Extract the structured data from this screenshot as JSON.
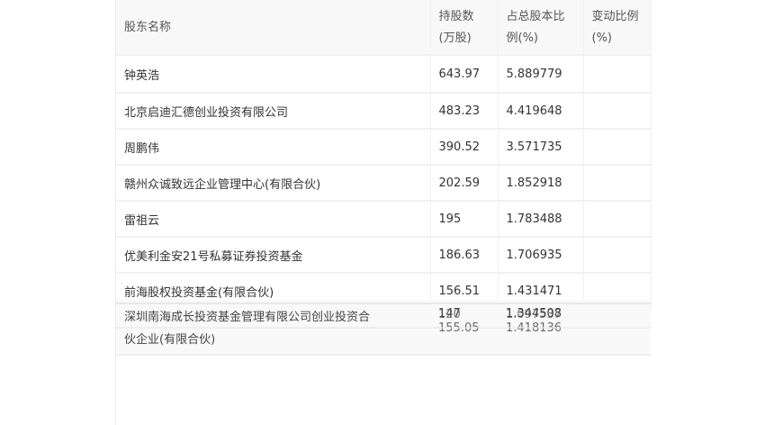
{
  "headers": {
    "name": "股东名称",
    "shares": "持股数(万股)",
    "ratio": "占总股本比例(%)",
    "change": "变动比例(%)"
  },
  "rows": [
    {
      "name": "钟英浩",
      "shares": "643.97",
      "ratio": "5.889779",
      "change": ""
    },
    {
      "name": "北京启迪汇德创业投资有限公司",
      "shares": "483.23",
      "ratio": "4.419648",
      "change": ""
    },
    {
      "name": "周鹏伟",
      "shares": "390.52",
      "ratio": "3.571735",
      "change": ""
    },
    {
      "name": "赣州众诚致远企业管理中心(有限合伙)",
      "shares": "202.59",
      "ratio": "1.852918",
      "change": ""
    },
    {
      "name": "雷祖云",
      "shares": "195",
      "ratio": "1.783488",
      "change": ""
    },
    {
      "name": "优美利金安21号私募证券投资基金",
      "shares": "186.63",
      "ratio": "1.706935",
      "change": ""
    },
    {
      "name": "前海股权投资基金(有限合伙)",
      "shares": "156.51",
      "ratio": "1.431471",
      "change": ""
    }
  ],
  "overlap": {
    "name_line1": "深圳南海成长投资基金管理有限公司创业投资合",
    "name_line2": "伙企业(有限合伙)",
    "shares_a": "147",
    "shares_b": "120",
    "shares_c": "155.05",
    "ratio_a": "1.344508",
    "ratio_b": "1.097537",
    "ratio_c": "1.418136"
  }
}
